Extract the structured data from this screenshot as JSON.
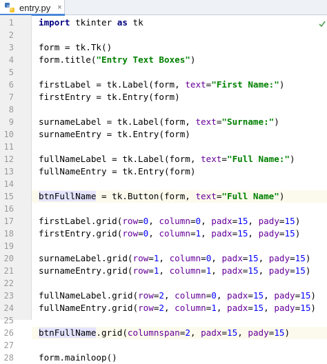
{
  "tab": {
    "filename": "entry.py",
    "close": "×"
  },
  "colors": {
    "keyword": "#000080",
    "string": "#008000",
    "kwarg": "#660099",
    "number": "#0000ff",
    "current_line": "#fcfaed"
  },
  "highlighted_lines": [
    15,
    26
  ],
  "lines": [
    {
      "n": "1",
      "tokens": [
        [
          "kw",
          "import"
        ],
        [
          "p",
          " tkinter "
        ],
        [
          "kw",
          "as"
        ],
        [
          "p",
          " tk"
        ]
      ]
    },
    {
      "n": "2",
      "tokens": []
    },
    {
      "n": "3",
      "tokens": [
        [
          "p",
          "form = tk.Tk()"
        ]
      ]
    },
    {
      "n": "4",
      "tokens": [
        [
          "p",
          "form.title("
        ],
        [
          "str",
          "\"Entry Text Boxes\""
        ],
        [
          "p",
          ")"
        ]
      ]
    },
    {
      "n": "5",
      "tokens": []
    },
    {
      "n": "6",
      "tokens": [
        [
          "p",
          "firstLabel = tk.Label(form, "
        ],
        [
          "kwarg",
          "text"
        ],
        [
          "p",
          "="
        ],
        [
          "str",
          "\"First Name:\""
        ],
        [
          "p",
          ")"
        ]
      ]
    },
    {
      "n": "7",
      "tokens": [
        [
          "p",
          "firstEntry = tk.Entry(form)"
        ]
      ]
    },
    {
      "n": "8",
      "tokens": []
    },
    {
      "n": "9",
      "tokens": [
        [
          "p",
          "surnameLabel = tk.Label(form, "
        ],
        [
          "kwarg",
          "text"
        ],
        [
          "p",
          "="
        ],
        [
          "str",
          "\"Surname:\""
        ],
        [
          "p",
          ")"
        ]
      ]
    },
    {
      "n": "10",
      "tokens": [
        [
          "p",
          "surnameEntry = tk.Entry(form)"
        ]
      ]
    },
    {
      "n": "11",
      "tokens": []
    },
    {
      "n": "12",
      "tokens": [
        [
          "p",
          "fullNameLabel = tk.Label(form, "
        ],
        [
          "kwarg",
          "text"
        ],
        [
          "p",
          "="
        ],
        [
          "str",
          "\"Full Name:\""
        ],
        [
          "p",
          ")"
        ]
      ]
    },
    {
      "n": "13",
      "tokens": [
        [
          "p",
          "fullNameEntry = tk.Entry(form)"
        ]
      ]
    },
    {
      "n": "14",
      "tokens": []
    },
    {
      "n": "15",
      "tokens": [
        [
          "sel",
          "btnFullName"
        ],
        [
          "p",
          " = tk.Button(form, "
        ],
        [
          "kwarg",
          "text"
        ],
        [
          "p",
          "="
        ],
        [
          "str",
          "\"Full Name\""
        ],
        [
          "p",
          ")"
        ]
      ]
    },
    {
      "n": "16",
      "tokens": []
    },
    {
      "n": "17",
      "tokens": [
        [
          "p",
          "firstLabel.grid("
        ],
        [
          "kwarg",
          "row"
        ],
        [
          "p",
          "="
        ],
        [
          "num",
          "0"
        ],
        [
          "p",
          ", "
        ],
        [
          "kwarg",
          "column"
        ],
        [
          "p",
          "="
        ],
        [
          "num",
          "0"
        ],
        [
          "p",
          ", "
        ],
        [
          "kwarg",
          "padx"
        ],
        [
          "p",
          "="
        ],
        [
          "num",
          "15"
        ],
        [
          "p",
          ", "
        ],
        [
          "kwarg",
          "pady"
        ],
        [
          "p",
          "="
        ],
        [
          "num",
          "15"
        ],
        [
          "p",
          ")"
        ]
      ]
    },
    {
      "n": "18",
      "tokens": [
        [
          "p",
          "firstEntry.grid("
        ],
        [
          "kwarg",
          "row"
        ],
        [
          "p",
          "="
        ],
        [
          "num",
          "0"
        ],
        [
          "p",
          ", "
        ],
        [
          "kwarg",
          "column"
        ],
        [
          "p",
          "="
        ],
        [
          "num",
          "1"
        ],
        [
          "p",
          ", "
        ],
        [
          "kwarg",
          "padx"
        ],
        [
          "p",
          "="
        ],
        [
          "num",
          "15"
        ],
        [
          "p",
          ", "
        ],
        [
          "kwarg",
          "pady"
        ],
        [
          "p",
          "="
        ],
        [
          "num",
          "15"
        ],
        [
          "p",
          ")"
        ]
      ]
    },
    {
      "n": "19",
      "tokens": []
    },
    {
      "n": "20",
      "tokens": [
        [
          "p",
          "surnameLabel.grid("
        ],
        [
          "kwarg",
          "row"
        ],
        [
          "p",
          "="
        ],
        [
          "num",
          "1"
        ],
        [
          "p",
          ", "
        ],
        [
          "kwarg",
          "column"
        ],
        [
          "p",
          "="
        ],
        [
          "num",
          "0"
        ],
        [
          "p",
          ", "
        ],
        [
          "kwarg",
          "padx"
        ],
        [
          "p",
          "="
        ],
        [
          "num",
          "15"
        ],
        [
          "p",
          ", "
        ],
        [
          "kwarg",
          "pady"
        ],
        [
          "p",
          "="
        ],
        [
          "num",
          "15"
        ],
        [
          "p",
          ")"
        ]
      ]
    },
    {
      "n": "21",
      "tokens": [
        [
          "p",
          "surnameEntry.grid("
        ],
        [
          "kwarg",
          "row"
        ],
        [
          "p",
          "="
        ],
        [
          "num",
          "1"
        ],
        [
          "p",
          ", "
        ],
        [
          "kwarg",
          "column"
        ],
        [
          "p",
          "="
        ],
        [
          "num",
          "1"
        ],
        [
          "p",
          ", "
        ],
        [
          "kwarg",
          "padx"
        ],
        [
          "p",
          "="
        ],
        [
          "num",
          "15"
        ],
        [
          "p",
          ", "
        ],
        [
          "kwarg",
          "pady"
        ],
        [
          "p",
          "="
        ],
        [
          "num",
          "15"
        ],
        [
          "p",
          ")"
        ]
      ]
    },
    {
      "n": "22",
      "tokens": []
    },
    {
      "n": "23",
      "tokens": [
        [
          "p",
          "fullNameLabel.grid("
        ],
        [
          "kwarg",
          "row"
        ],
        [
          "p",
          "="
        ],
        [
          "num",
          "2"
        ],
        [
          "p",
          ", "
        ],
        [
          "kwarg",
          "column"
        ],
        [
          "p",
          "="
        ],
        [
          "num",
          "0"
        ],
        [
          "p",
          ", "
        ],
        [
          "kwarg",
          "padx"
        ],
        [
          "p",
          "="
        ],
        [
          "num",
          "15"
        ],
        [
          "p",
          ", "
        ],
        [
          "kwarg",
          "pady"
        ],
        [
          "p",
          "="
        ],
        [
          "num",
          "15"
        ],
        [
          "p",
          ")"
        ]
      ]
    },
    {
      "n": "24",
      "tokens": [
        [
          "p",
          "fullNameEntry.grid("
        ],
        [
          "kwarg",
          "row"
        ],
        [
          "p",
          "="
        ],
        [
          "num",
          "2"
        ],
        [
          "p",
          ", "
        ],
        [
          "kwarg",
          "column"
        ],
        [
          "p",
          "="
        ],
        [
          "num",
          "1"
        ],
        [
          "p",
          ", "
        ],
        [
          "kwarg",
          "padx"
        ],
        [
          "p",
          "="
        ],
        [
          "num",
          "15"
        ],
        [
          "p",
          ", "
        ],
        [
          "kwarg",
          "pady"
        ],
        [
          "p",
          "="
        ],
        [
          "num",
          "15"
        ],
        [
          "p",
          ")"
        ]
      ]
    },
    {
      "n": "25",
      "tokens": []
    },
    {
      "n": "26",
      "tokens": [
        [
          "sel",
          "btnFullName"
        ],
        [
          "p",
          ".grid("
        ],
        [
          "kwarg",
          "columnspan"
        ],
        [
          "p",
          "="
        ],
        [
          "num",
          "2"
        ],
        [
          "p",
          ", "
        ],
        [
          "kwarg",
          "padx"
        ],
        [
          "p",
          "="
        ],
        [
          "num",
          "15"
        ],
        [
          "p",
          ", "
        ],
        [
          "kwarg",
          "pady"
        ],
        [
          "p",
          "="
        ],
        [
          "num",
          "15"
        ],
        [
          "p",
          ")"
        ]
      ]
    },
    {
      "n": "27",
      "tokens": []
    },
    {
      "n": "28",
      "tokens": [
        [
          "p",
          "form.mainloop()"
        ]
      ]
    }
  ]
}
